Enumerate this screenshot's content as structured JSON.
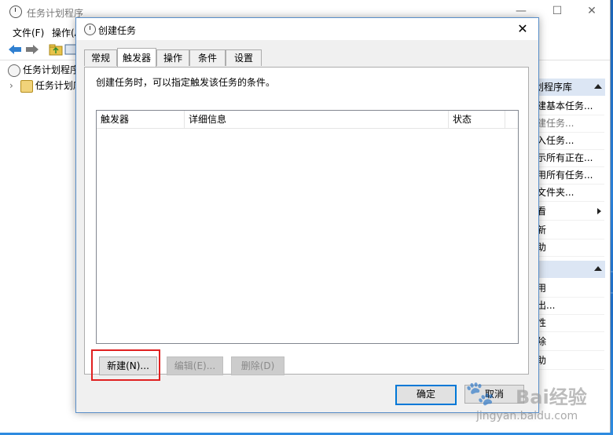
{
  "main_window": {
    "title": "任务计划程序",
    "controls": {
      "minimize": "—",
      "maximize": "☐",
      "close": "✕"
    },
    "menu": [
      "文件(F)",
      "操作(A"
    ],
    "tree": {
      "root": "任务计划程序",
      "child": "任务计划库"
    },
    "actions": {
      "header1": "划程序库",
      "items1": [
        "建基本任务...",
        "建任务...",
        "入任务...",
        "示所有正在...",
        "用所有任务...",
        "文件夹...",
        "看",
        "新",
        "助"
      ],
      "items2": [
        "用",
        "出...",
        "性",
        "除",
        "助"
      ]
    }
  },
  "dialog": {
    "title": "创建任务",
    "close_glyph": "✕",
    "tabs": [
      "常规",
      "触发器",
      "操作",
      "条件",
      "设置"
    ],
    "active_tab": "触发器",
    "description": "创建任务时，可以指定触发该任务的条件。",
    "list_columns": [
      "触发器",
      "详细信息",
      "状态"
    ],
    "buttons": {
      "new": "新建(N)...",
      "edit": "编辑(E)...",
      "delete": "删除(D)",
      "ok": "确定",
      "cancel": "取消"
    }
  },
  "watermark": {
    "brand": "Bai经验",
    "url": "jingyan.baidu.com"
  },
  "colors": {
    "accent": "#0078d7",
    "highlight": "#e02020",
    "desktop": "#1e6cc4"
  }
}
